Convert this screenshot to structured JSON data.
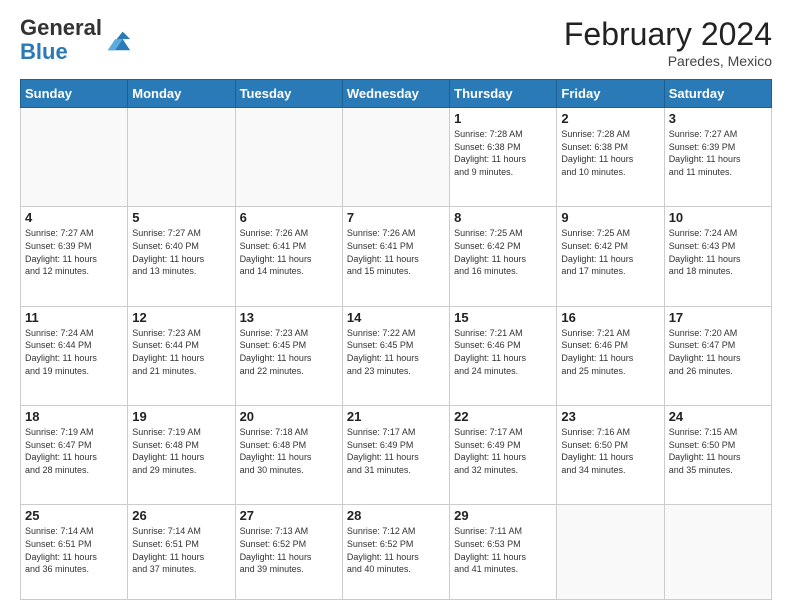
{
  "header": {
    "logo_general": "General",
    "logo_blue": "Blue",
    "month_year": "February 2024",
    "location": "Paredes, Mexico"
  },
  "weekdays": [
    "Sunday",
    "Monday",
    "Tuesday",
    "Wednesday",
    "Thursday",
    "Friday",
    "Saturday"
  ],
  "weeks": [
    [
      {
        "day": "",
        "info": ""
      },
      {
        "day": "",
        "info": ""
      },
      {
        "day": "",
        "info": ""
      },
      {
        "day": "",
        "info": ""
      },
      {
        "day": "1",
        "info": "Sunrise: 7:28 AM\nSunset: 6:38 PM\nDaylight: 11 hours\nand 9 minutes."
      },
      {
        "day": "2",
        "info": "Sunrise: 7:28 AM\nSunset: 6:38 PM\nDaylight: 11 hours\nand 10 minutes."
      },
      {
        "day": "3",
        "info": "Sunrise: 7:27 AM\nSunset: 6:39 PM\nDaylight: 11 hours\nand 11 minutes."
      }
    ],
    [
      {
        "day": "4",
        "info": "Sunrise: 7:27 AM\nSunset: 6:39 PM\nDaylight: 11 hours\nand 12 minutes."
      },
      {
        "day": "5",
        "info": "Sunrise: 7:27 AM\nSunset: 6:40 PM\nDaylight: 11 hours\nand 13 minutes."
      },
      {
        "day": "6",
        "info": "Sunrise: 7:26 AM\nSunset: 6:41 PM\nDaylight: 11 hours\nand 14 minutes."
      },
      {
        "day": "7",
        "info": "Sunrise: 7:26 AM\nSunset: 6:41 PM\nDaylight: 11 hours\nand 15 minutes."
      },
      {
        "day": "8",
        "info": "Sunrise: 7:25 AM\nSunset: 6:42 PM\nDaylight: 11 hours\nand 16 minutes."
      },
      {
        "day": "9",
        "info": "Sunrise: 7:25 AM\nSunset: 6:42 PM\nDaylight: 11 hours\nand 17 minutes."
      },
      {
        "day": "10",
        "info": "Sunrise: 7:24 AM\nSunset: 6:43 PM\nDaylight: 11 hours\nand 18 minutes."
      }
    ],
    [
      {
        "day": "11",
        "info": "Sunrise: 7:24 AM\nSunset: 6:44 PM\nDaylight: 11 hours\nand 19 minutes."
      },
      {
        "day": "12",
        "info": "Sunrise: 7:23 AM\nSunset: 6:44 PM\nDaylight: 11 hours\nand 21 minutes."
      },
      {
        "day": "13",
        "info": "Sunrise: 7:23 AM\nSunset: 6:45 PM\nDaylight: 11 hours\nand 22 minutes."
      },
      {
        "day": "14",
        "info": "Sunrise: 7:22 AM\nSunset: 6:45 PM\nDaylight: 11 hours\nand 23 minutes."
      },
      {
        "day": "15",
        "info": "Sunrise: 7:21 AM\nSunset: 6:46 PM\nDaylight: 11 hours\nand 24 minutes."
      },
      {
        "day": "16",
        "info": "Sunrise: 7:21 AM\nSunset: 6:46 PM\nDaylight: 11 hours\nand 25 minutes."
      },
      {
        "day": "17",
        "info": "Sunrise: 7:20 AM\nSunset: 6:47 PM\nDaylight: 11 hours\nand 26 minutes."
      }
    ],
    [
      {
        "day": "18",
        "info": "Sunrise: 7:19 AM\nSunset: 6:47 PM\nDaylight: 11 hours\nand 28 minutes."
      },
      {
        "day": "19",
        "info": "Sunrise: 7:19 AM\nSunset: 6:48 PM\nDaylight: 11 hours\nand 29 minutes."
      },
      {
        "day": "20",
        "info": "Sunrise: 7:18 AM\nSunset: 6:48 PM\nDaylight: 11 hours\nand 30 minutes."
      },
      {
        "day": "21",
        "info": "Sunrise: 7:17 AM\nSunset: 6:49 PM\nDaylight: 11 hours\nand 31 minutes."
      },
      {
        "day": "22",
        "info": "Sunrise: 7:17 AM\nSunset: 6:49 PM\nDaylight: 11 hours\nand 32 minutes."
      },
      {
        "day": "23",
        "info": "Sunrise: 7:16 AM\nSunset: 6:50 PM\nDaylight: 11 hours\nand 34 minutes."
      },
      {
        "day": "24",
        "info": "Sunrise: 7:15 AM\nSunset: 6:50 PM\nDaylight: 11 hours\nand 35 minutes."
      }
    ],
    [
      {
        "day": "25",
        "info": "Sunrise: 7:14 AM\nSunset: 6:51 PM\nDaylight: 11 hours\nand 36 minutes."
      },
      {
        "day": "26",
        "info": "Sunrise: 7:14 AM\nSunset: 6:51 PM\nDaylight: 11 hours\nand 37 minutes."
      },
      {
        "day": "27",
        "info": "Sunrise: 7:13 AM\nSunset: 6:52 PM\nDaylight: 11 hours\nand 39 minutes."
      },
      {
        "day": "28",
        "info": "Sunrise: 7:12 AM\nSunset: 6:52 PM\nDaylight: 11 hours\nand 40 minutes."
      },
      {
        "day": "29",
        "info": "Sunrise: 7:11 AM\nSunset: 6:53 PM\nDaylight: 11 hours\nand 41 minutes."
      },
      {
        "day": "",
        "info": ""
      },
      {
        "day": "",
        "info": ""
      }
    ]
  ]
}
